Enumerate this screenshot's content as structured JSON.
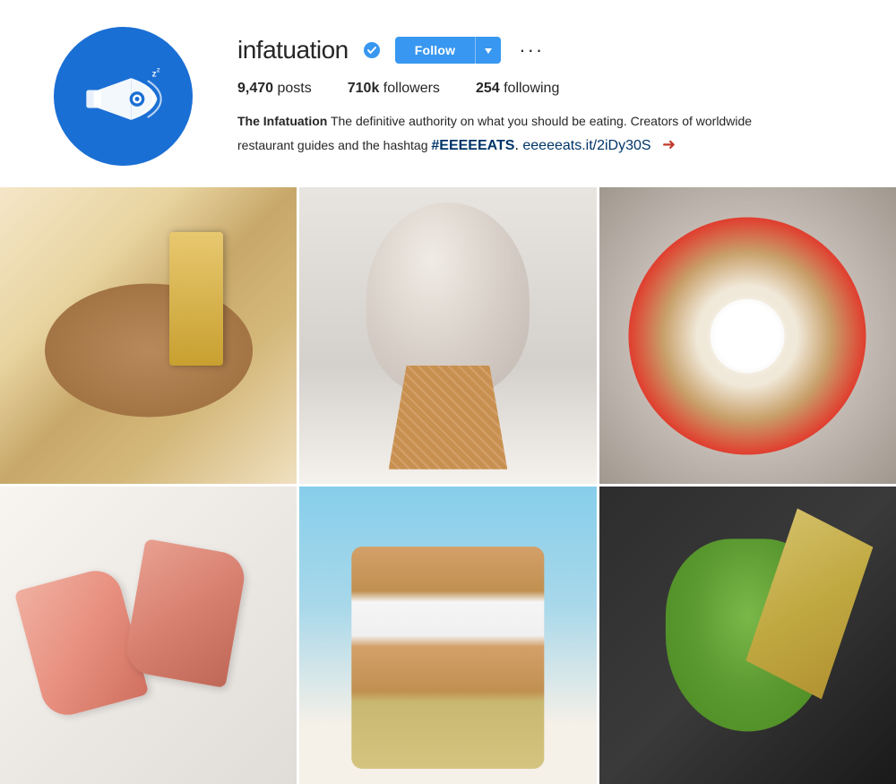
{
  "profile": {
    "username": "infatuation",
    "verified": true,
    "stats": {
      "posts_count": "9,470",
      "posts_label": "posts",
      "followers_count": "710k",
      "followers_label": "followers",
      "following_count": "254",
      "following_label": "following"
    },
    "bio": {
      "name": "The Infatuation",
      "description": " The definitive authority on what you should be eating. Creators of worldwide restaurant guides and the hashtag ",
      "hashtag": "#EEEEEATS",
      "separator": ".",
      "link": "eeeeeats.it/2iDy30S"
    },
    "buttons": {
      "follow": "Follow",
      "more_options": "···"
    }
  },
  "photos": [
    {
      "id": "pancake",
      "alt": "Pancake with syrup being poured"
    },
    {
      "id": "icecream",
      "alt": "Soft serve ice cream cone with sprinkles"
    },
    {
      "id": "pizza",
      "alt": "Pizza with arugula and egg"
    },
    {
      "id": "sushi",
      "alt": "Sliced sashimi pieces"
    },
    {
      "id": "cookie-sandwich",
      "alt": "Ice cream cookie sandwich with sprinkles"
    },
    {
      "id": "guacamole",
      "alt": "Guacamole in stone bowl with chips"
    }
  ]
}
